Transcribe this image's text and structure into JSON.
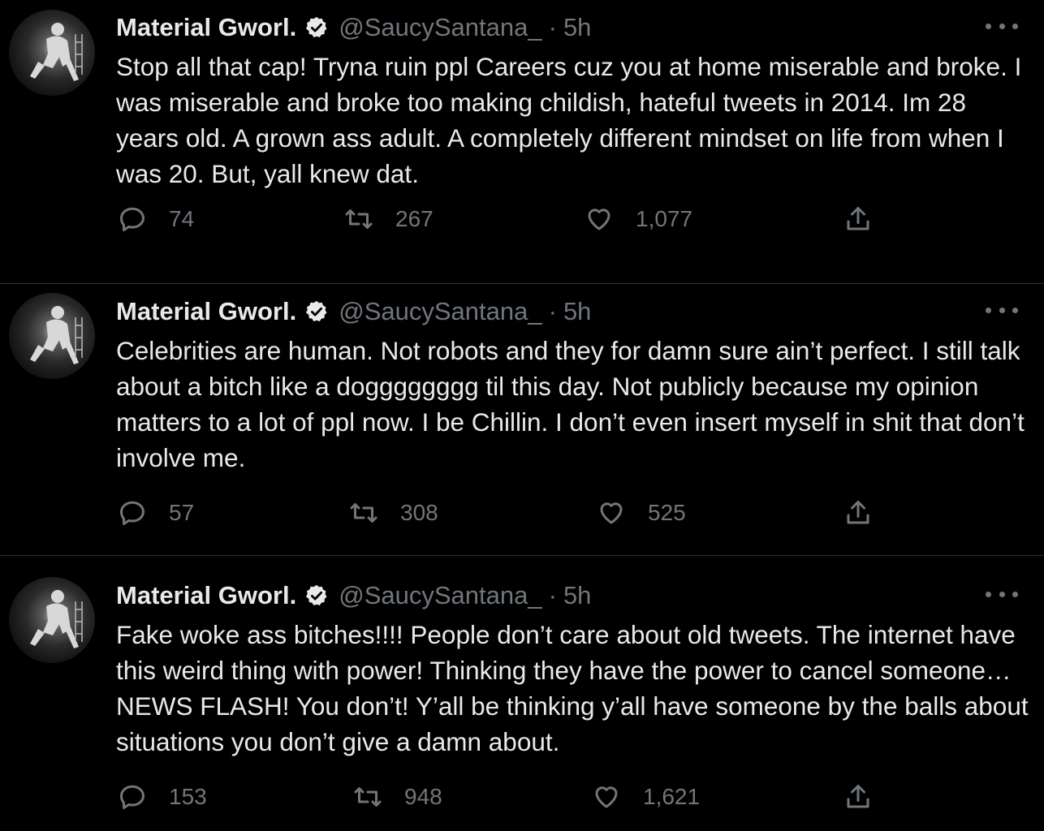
{
  "tweets": [
    {
      "name": "Material Gworl.",
      "handle": "@SaucySantana_",
      "dot": "·",
      "time": "5h",
      "text": "Stop all that cap! Tryna ruin ppl Careers cuz you at home miserable and broke. I was miserable and broke too making childish, hateful tweets in 2014. Im 28 years old. A grown ass adult. A completely different mindset on life from when I was 20.  But, yall knew dat.",
      "replies": "74",
      "retweets": "267",
      "likes": "1,077"
    },
    {
      "name": "Material Gworl.",
      "handle": "@SaucySantana_",
      "dot": "·",
      "time": "5h",
      "text": "Celebrities are human. Not robots and they for damn sure ain’t perfect. I still talk about a bitch like a dogggggggg til this day. Not publicly because my opinion matters to a lot of ppl now. I be Chillin. I don’t even insert myself in shit that don’t involve me.",
      "replies": "57",
      "retweets": "308",
      "likes": "525"
    },
    {
      "name": "Material Gworl.",
      "handle": "@SaucySantana_",
      "dot": "·",
      "time": "5h",
      "text": "Fake woke ass bitches!!!! People don’t care about old tweets. The internet have this weird thing with power! Thinking they have the power to cancel someone… NEWS FLASH! You don’t! Y’all be thinking y’all have someone by the balls about situations you don’t give a damn about.",
      "replies": "153",
      "retweets": "948",
      "likes": "1,621"
    }
  ],
  "icons": {
    "reply": "reply-icon",
    "retweet": "retweet-icon",
    "like": "heart-icon",
    "share": "share-icon",
    "more": "more-icon",
    "verified": "verified-badge-icon"
  },
  "colors": {
    "background": "#000000",
    "text": "#e7e9ea",
    "muted": "#71767b",
    "divider": "#2f3336"
  }
}
